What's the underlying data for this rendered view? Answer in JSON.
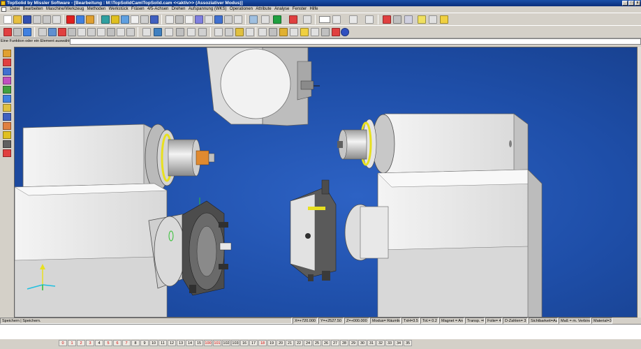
{
  "window": {
    "title": "TopSolid by Missler Software - [Bearbeitung : M:\\TopSolidCam\\TopSolid.cam  <<aktiv>> (Assoziativer Modus)]"
  },
  "menu": [
    "Datei",
    "Bearbeiten",
    "Maschine/Werkzeug",
    "Methoden",
    "Werkstück",
    "Fräsen",
    "4/5-Achsen",
    "Drehen",
    "Aufspannung (WKS)",
    "Operationen",
    "Attribute",
    "Analyse",
    "Fenster",
    "Hilfe"
  ],
  "prompt": {
    "label": "Eine Funktion oder ein Element auswählen",
    "value": ""
  },
  "status": {
    "message": "Speichern | Speichern.",
    "cells": [
      "X=+720.000",
      "Y=+2527.50",
      "Z=+000.000",
      "Modus= Räumlich",
      "TxH=3.5",
      "Tol.= 0.2",
      "Magnet = An",
      "Transp. =0",
      "Folie= 4",
      "D-Zahlen= 3",
      "Sichtbarkeit=Aus",
      "Maß = m. Verbindung",
      "Material=300 HV"
    ]
  },
  "pages": [
    {
      "label": "0",
      "red": true
    },
    {
      "label": "1",
      "red": true
    },
    {
      "label": "2",
      "red": true
    },
    {
      "label": "3",
      "red": true
    },
    {
      "label": "4",
      "red": false
    },
    {
      "label": "5",
      "red": true
    },
    {
      "label": "6",
      "red": true
    },
    {
      "label": "7",
      "red": true
    },
    {
      "label": "8",
      "red": false
    },
    {
      "label": "9",
      "red": false
    },
    {
      "label": "10",
      "red": false
    },
    {
      "label": "11",
      "red": false
    },
    {
      "label": "12",
      "red": false
    },
    {
      "label": "13",
      "red": false
    },
    {
      "label": "14",
      "red": false
    },
    {
      "label": "15",
      "red": false
    },
    {
      "label": "100",
      "red": true
    },
    {
      "label": "101",
      "red": true
    },
    {
      "label": "102",
      "red": false
    },
    {
      "label": "103",
      "red": false
    },
    {
      "label": "16",
      "red": false
    },
    {
      "label": "17",
      "red": false
    },
    {
      "label": "18",
      "red": true
    },
    {
      "label": "19",
      "red": false
    },
    {
      "label": "20",
      "red": false
    },
    {
      "label": "21",
      "red": false
    },
    {
      "label": "22",
      "red": false
    },
    {
      "label": "24",
      "red": false
    },
    {
      "label": "25",
      "red": false
    },
    {
      "label": "26",
      "red": false
    },
    {
      "label": "27",
      "red": false
    },
    {
      "label": "28",
      "red": false
    },
    {
      "label": "29",
      "red": false
    },
    {
      "label": "30",
      "red": false
    },
    {
      "label": "31",
      "red": false
    },
    {
      "label": "32",
      "red": false
    },
    {
      "label": "33",
      "red": false
    },
    {
      "label": "34",
      "red": false
    },
    {
      "label": "35",
      "red": false
    }
  ],
  "colors": {
    "viewport_bg": "#1e4ea8",
    "titlebar": "#0a2e7c",
    "machine_body": "#ececec",
    "accent_ring": "#e8e020"
  }
}
